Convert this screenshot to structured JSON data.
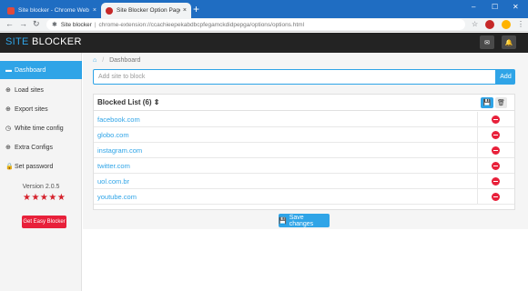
{
  "browser": {
    "tabs": [
      {
        "title": "Site blocker - Chrome Web Store",
        "close": "×"
      },
      {
        "title": "Site Blocker Option Page",
        "close": "×"
      }
    ],
    "new_tab": "+",
    "window_controls": {
      "minimize": "–",
      "maximize": "☐",
      "close": "✕"
    },
    "nav": {
      "back": "←",
      "forward": "→",
      "reload": "↻"
    },
    "omnibox": {
      "site_name": "Site blocker",
      "separator": "|",
      "url": "chrome-extension://ccachieepekabdbcpfegamckdidpepga/options/options.html"
    },
    "star": "☆",
    "menu": "⋮"
  },
  "header": {
    "brand_site": "SITE",
    "brand_blocker": "BLOCKER",
    "mail_icon": "✉",
    "bell_icon": "🔔"
  },
  "sidebar": {
    "items": [
      {
        "label": "Dashboard",
        "icon": "▬"
      },
      {
        "label": "Load sites",
        "icon": "⊕"
      },
      {
        "label": "Export sites",
        "icon": "⊕"
      },
      {
        "label": "White time config",
        "icon": "◷"
      },
      {
        "label": "Extra Configs",
        "icon": "⊕"
      },
      {
        "label": "Set password",
        "icon": "🔒"
      }
    ],
    "version": "Version 2.0.5",
    "rating": 4.5,
    "stars": "★★★★★",
    "easy_blocker_label": "Get Easy Blocker"
  },
  "main": {
    "breadcrumb": {
      "home_icon": "⌂",
      "separator": "/",
      "current": "Dashboard"
    },
    "add_input": {
      "placeholder": "Add site to block",
      "value": ""
    },
    "add_button": "Add",
    "blocked_list": {
      "title": "Blocked List (6) ⇕",
      "save_icon": "💾",
      "delete_icon": "🗑",
      "sites": [
        "facebook.com",
        "globo.com",
        "instagram.com",
        "twitter.com",
        "uol.com.br",
        "youtube.com"
      ]
    },
    "save_changes": {
      "icon": "💾",
      "label": "Save changes"
    }
  },
  "colors": {
    "accent": "#2fa4e7",
    "header_bg": "#232323",
    "danger": "#e8203a",
    "tab_strip": "#1f6dc2"
  }
}
